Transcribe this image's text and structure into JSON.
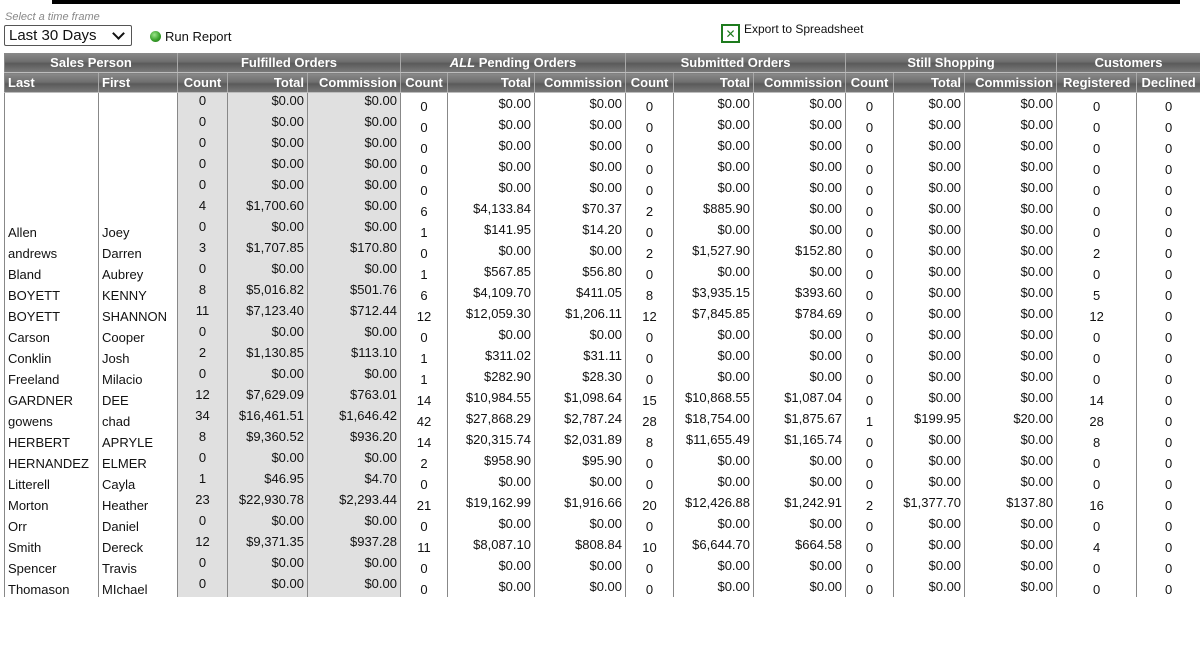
{
  "controls": {
    "timeframe_label": "Select a time frame",
    "timeframe_value": "Last 30 Days",
    "run_report_label": "Run Report",
    "export_label": "Export to Spreadsheet",
    "export_icon": "excel-icon",
    "run_icon": "green-dot-icon"
  },
  "table": {
    "groups": [
      {
        "label": "Sales Person",
        "span": 2
      },
      {
        "label": "Fulfilled Orders",
        "span": 3
      },
      {
        "label_em": "ALL",
        "label": " Pending Orders",
        "span": 3
      },
      {
        "label": "Submitted Orders",
        "span": 3
      },
      {
        "label": "Still Shopping",
        "span": 3
      },
      {
        "label": "Customers",
        "span": 2
      }
    ],
    "columns": [
      "Last",
      "First",
      "Count",
      "Total",
      "Commission",
      "Count",
      "Total",
      "Commission",
      "Count",
      "Total",
      "Commission",
      "Count",
      "Total",
      "Commission",
      "Registered",
      "Declined"
    ],
    "rows": [
      [
        "",
        "",
        "0",
        "$0.00",
        "$0.00",
        "0",
        "$0.00",
        "$0.00",
        "0",
        "$0.00",
        "$0.00",
        "0",
        "$0.00",
        "$0.00",
        "0",
        "0"
      ],
      [
        "",
        "",
        "0",
        "$0.00",
        "$0.00",
        "0",
        "$0.00",
        "$0.00",
        "0",
        "$0.00",
        "$0.00",
        "0",
        "$0.00",
        "$0.00",
        "0",
        "0"
      ],
      [
        "",
        "",
        "0",
        "$0.00",
        "$0.00",
        "0",
        "$0.00",
        "$0.00",
        "0",
        "$0.00",
        "$0.00",
        "0",
        "$0.00",
        "$0.00",
        "0",
        "0"
      ],
      [
        "",
        "",
        "0",
        "$0.00",
        "$0.00",
        "0",
        "$0.00",
        "$0.00",
        "0",
        "$0.00",
        "$0.00",
        "0",
        "$0.00",
        "$0.00",
        "0",
        "0"
      ],
      [
        "",
        "",
        "0",
        "$0.00",
        "$0.00",
        "0",
        "$0.00",
        "$0.00",
        "0",
        "$0.00",
        "$0.00",
        "0",
        "$0.00",
        "$0.00",
        "0",
        "0"
      ],
      [
        "",
        "",
        "4",
        "$1,700.60",
        "$0.00",
        "6",
        "$4,133.84",
        "$70.37",
        "2",
        "$885.90",
        "$0.00",
        "0",
        "$0.00",
        "$0.00",
        "0",
        "0"
      ],
      [
        "Allen",
        "Joey",
        "0",
        "$0.00",
        "$0.00",
        "1",
        "$141.95",
        "$14.20",
        "0",
        "$0.00",
        "$0.00",
        "0",
        "$0.00",
        "$0.00",
        "0",
        "0"
      ],
      [
        "andrews",
        "Darren",
        "3",
        "$1,707.85",
        "$170.80",
        "0",
        "$0.00",
        "$0.00",
        "2",
        "$1,527.90",
        "$152.80",
        "0",
        "$0.00",
        "$0.00",
        "2",
        "0"
      ],
      [
        "Bland",
        "Aubrey",
        "0",
        "$0.00",
        "$0.00",
        "1",
        "$567.85",
        "$56.80",
        "0",
        "$0.00",
        "$0.00",
        "0",
        "$0.00",
        "$0.00",
        "0",
        "0"
      ],
      [
        "BOYETT",
        "KENNY",
        "8",
        "$5,016.82",
        "$501.76",
        "6",
        "$4,109.70",
        "$411.05",
        "8",
        "$3,935.15",
        "$393.60",
        "0",
        "$0.00",
        "$0.00",
        "5",
        "0"
      ],
      [
        "BOYETT",
        "SHANNON",
        "11",
        "$7,123.40",
        "$712.44",
        "12",
        "$12,059.30",
        "$1,206.11",
        "12",
        "$7,845.85",
        "$784.69",
        "0",
        "$0.00",
        "$0.00",
        "12",
        "0"
      ],
      [
        "Carson",
        "Cooper",
        "0",
        "$0.00",
        "$0.00",
        "0",
        "$0.00",
        "$0.00",
        "0",
        "$0.00",
        "$0.00",
        "0",
        "$0.00",
        "$0.00",
        "0",
        "0"
      ],
      [
        "Conklin",
        "Josh",
        "2",
        "$1,130.85",
        "$113.10",
        "1",
        "$311.02",
        "$31.11",
        "0",
        "$0.00",
        "$0.00",
        "0",
        "$0.00",
        "$0.00",
        "0",
        "0"
      ],
      [
        "Freeland",
        "Milacio",
        "0",
        "$0.00",
        "$0.00",
        "1",
        "$282.90",
        "$28.30",
        "0",
        "$0.00",
        "$0.00",
        "0",
        "$0.00",
        "$0.00",
        "0",
        "0"
      ],
      [
        "GARDNER",
        "DEE",
        "12",
        "$7,629.09",
        "$763.01",
        "14",
        "$10,984.55",
        "$1,098.64",
        "15",
        "$10,868.55",
        "$1,087.04",
        "0",
        "$0.00",
        "$0.00",
        "14",
        "0"
      ],
      [
        "gowens",
        "chad",
        "34",
        "$16,461.51",
        "$1,646.42",
        "42",
        "$27,868.29",
        "$2,787.24",
        "28",
        "$18,754.00",
        "$1,875.67",
        "1",
        "$199.95",
        "$20.00",
        "28",
        "0"
      ],
      [
        "HERBERT",
        "APRYLE",
        "8",
        "$9,360.52",
        "$936.20",
        "14",
        "$20,315.74",
        "$2,031.89",
        "8",
        "$11,655.49",
        "$1,165.74",
        "0",
        "$0.00",
        "$0.00",
        "8",
        "0"
      ],
      [
        "HERNANDEZ",
        "ELMER",
        "0",
        "$0.00",
        "$0.00",
        "2",
        "$958.90",
        "$95.90",
        "0",
        "$0.00",
        "$0.00",
        "0",
        "$0.00",
        "$0.00",
        "0",
        "0"
      ],
      [
        "Litterell",
        "Cayla",
        "1",
        "$46.95",
        "$4.70",
        "0",
        "$0.00",
        "$0.00",
        "0",
        "$0.00",
        "$0.00",
        "0",
        "$0.00",
        "$0.00",
        "0",
        "0"
      ],
      [
        "Morton",
        "Heather",
        "23",
        "$22,930.78",
        "$2,293.44",
        "21",
        "$19,162.99",
        "$1,916.66",
        "20",
        "$12,426.88",
        "$1,242.91",
        "2",
        "$1,377.70",
        "$137.80",
        "16",
        "0"
      ],
      [
        "Orr",
        "Daniel",
        "0",
        "$0.00",
        "$0.00",
        "0",
        "$0.00",
        "$0.00",
        "0",
        "$0.00",
        "$0.00",
        "0",
        "$0.00",
        "$0.00",
        "0",
        "0"
      ],
      [
        "Smith",
        "Dereck",
        "12",
        "$9,371.35",
        "$937.28",
        "11",
        "$8,087.10",
        "$808.84",
        "10",
        "$6,644.70",
        "$664.58",
        "0",
        "$0.00",
        "$0.00",
        "4",
        "0"
      ],
      [
        "Spencer",
        "Travis",
        "0",
        "$0.00",
        "$0.00",
        "0",
        "$0.00",
        "$0.00",
        "0",
        "$0.00",
        "$0.00",
        "0",
        "$0.00",
        "$0.00",
        "0",
        "0"
      ],
      [
        "Thomason",
        "MIchael",
        "0",
        "$0.00",
        "$0.00",
        "0",
        "$0.00",
        "$0.00",
        "0",
        "$0.00",
        "$0.00",
        "0",
        "$0.00",
        "$0.00",
        "0",
        "0"
      ]
    ]
  }
}
